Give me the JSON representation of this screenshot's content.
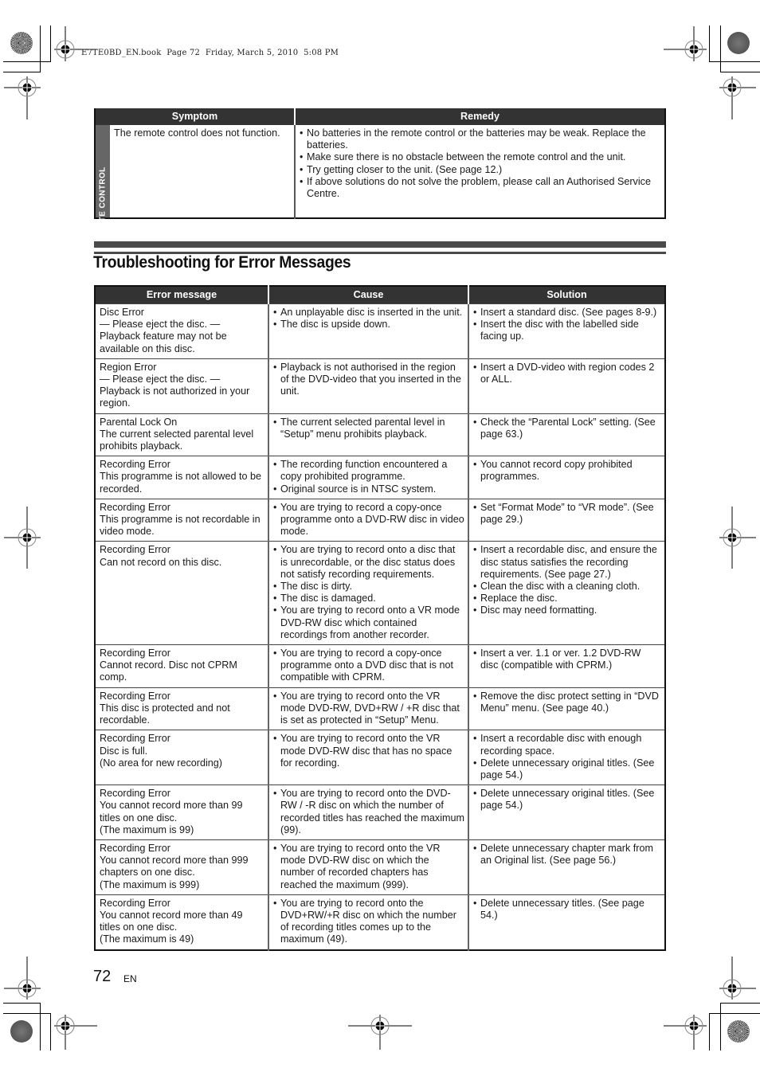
{
  "print_header": "E7TE0BD_EN.book  Page 72  Friday, March 5, 2010  5:08 PM",
  "remote_section": {
    "side_label": "REMOTE CONTROL",
    "headers": [
      "Symptom",
      "Remedy"
    ],
    "symptom": "The remote control does not function.",
    "remedies": [
      "No batteries in the remote control or the batteries may be weak. Replace the batteries.",
      "Make sure there is no obstacle between the remote control and the unit.",
      "Try getting closer to the unit. (See page 12.)",
      "If above solutions do not solve the problem, please call an Authorised Service Centre."
    ]
  },
  "section_title": "Troubleshooting for Error Messages",
  "error_table": {
    "headers": [
      "Error message",
      "Cause",
      "Solution"
    ],
    "rows": [
      {
        "message": [
          "Disc Error",
          "— Please eject the disc. —",
          "Playback feature may not be available on this disc."
        ],
        "causes": [
          "An unplayable disc is inserted in the unit.",
          "The disc is upside down."
        ],
        "solutions": [
          "Insert a standard disc. (See pages 8-9.)",
          "Insert the disc with the labelled side facing up."
        ]
      },
      {
        "message": [
          "Region Error",
          "— Please eject the disc. —",
          "Playback is not authorized in your region."
        ],
        "causes": [
          "Playback is not authorised in the region of the DVD-video that you inserted in the unit."
        ],
        "solutions": [
          "Insert a DVD-video with region codes 2 or ALL."
        ]
      },
      {
        "message": [
          "Parental Lock On",
          "The current selected parental level prohibits playback."
        ],
        "causes": [
          "The current selected parental level in “Setup” menu prohibits playback."
        ],
        "solutions": [
          "Check the “Parental Lock” setting. (See page 63.)"
        ]
      },
      {
        "message": [
          "Recording Error",
          "This programme is not allowed to be recorded."
        ],
        "causes": [
          "The recording function encountered a copy prohibited programme.",
          "Original source is in NTSC system."
        ],
        "solutions": [
          "You cannot record copy prohibited programmes."
        ]
      },
      {
        "message": [
          "Recording Error",
          "This programme is not recordable in video mode."
        ],
        "causes": [
          "You are trying to record a copy-once programme onto a DVD-RW disc in video mode."
        ],
        "solutions": [
          "Set “Format Mode” to “VR mode”. (See page 29.)"
        ]
      },
      {
        "message": [
          "Recording Error",
          "Can not record on this disc."
        ],
        "causes": [
          "You are trying to record onto a disc that is unrecordable, or the disc status does not satisfy recording requirements.",
          "The disc is dirty.",
          "The disc is damaged.",
          "You are trying to record onto a VR mode DVD-RW disc which contained recordings from another recorder."
        ],
        "solutions": [
          "Insert a recordable disc, and ensure the disc status satisfies the recording requirements. (See page 27.)",
          "Clean the disc with a cleaning cloth.",
          "Replace the disc.",
          "Disc may need formatting."
        ]
      },
      {
        "message": [
          "Recording Error",
          "Cannot record. Disc not CPRM comp."
        ],
        "causes": [
          "You are trying to record a copy-once programme onto a DVD disc that is not compatible with CPRM."
        ],
        "solutions": [
          "Insert a ver. 1.1 or ver. 1.2 DVD-RW disc (compatible with CPRM.)"
        ]
      },
      {
        "message": [
          "Recording Error",
          "This disc is protected and not recordable."
        ],
        "causes": [
          "You are trying to record onto the VR mode DVD-RW, DVD+RW / +R disc that is set as protected in “Setup” Menu."
        ],
        "solutions": [
          "Remove the disc protect setting in “DVD Menu” menu. (See page 40.)"
        ]
      },
      {
        "message": [
          "Recording Error",
          "Disc is full.",
          "(No area for new recording)"
        ],
        "causes": [
          "You are trying to record onto the VR mode DVD-RW disc that has no space for recording."
        ],
        "solutions": [
          "Insert a recordable disc with enough recording space.",
          "Delete unnecessary original titles. (See page 54.)"
        ]
      },
      {
        "message": [
          "Recording Error",
          "You cannot record more than 99 titles on one disc.",
          "(The maximum is 99)"
        ],
        "causes": [
          "You are trying to record onto the DVD-RW / -R disc on which the number of recorded titles has reached the maximum (99)."
        ],
        "solutions": [
          "Delete unnecessary original titles. (See page 54.)"
        ]
      },
      {
        "message": [
          "Recording Error",
          "You cannot record more than 999 chapters on one disc.",
          "(The maximum is 999)"
        ],
        "causes": [
          "You are trying to record onto the VR mode DVD-RW disc on which the number of recorded chapters has reached the maximum (999)."
        ],
        "solutions": [
          "Delete unnecessary chapter mark from an Original list. (See page 56.)"
        ]
      },
      {
        "message": [
          "Recording Error",
          "You cannot record more than 49 titles on one disc.",
          "(The maximum is 49)"
        ],
        "causes": [
          "You are trying to record onto the DVD+RW/+R disc on which the number of recording titles comes up to the maximum (49)."
        ],
        "solutions": [
          "Delete unnecessary titles. (See page 54.)"
        ]
      }
    ]
  },
  "footer": {
    "page_number": "72",
    "language": "EN"
  }
}
